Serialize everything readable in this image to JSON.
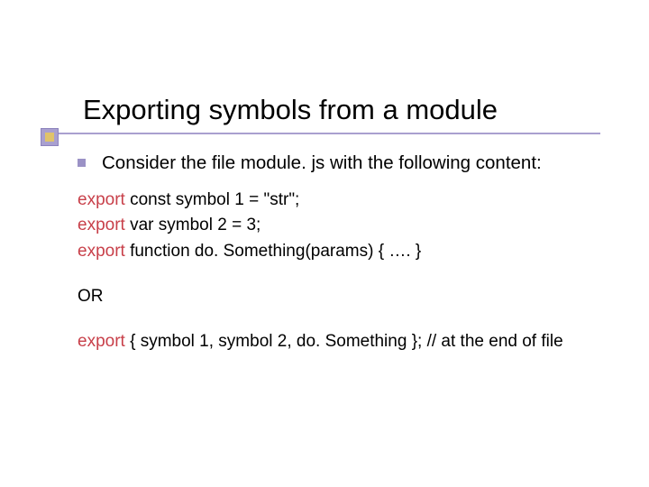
{
  "title": "Exporting symbols from a module",
  "bullet": {
    "text": "Consider the file module. js with the following content:"
  },
  "code": {
    "line1_kw": "export",
    "line1_rest": " const symbol 1 = \"str\";",
    "line2_kw": "export",
    "line2_rest": " var symbol 2 = 3;",
    "line3_kw": "export",
    "line3_rest": " function do. Something(params) { …. }"
  },
  "or_label": "OR",
  "export_last": {
    "kw": "export",
    "rest": " { symbol 1, symbol 2, do. Something }; //  at the end of file"
  }
}
